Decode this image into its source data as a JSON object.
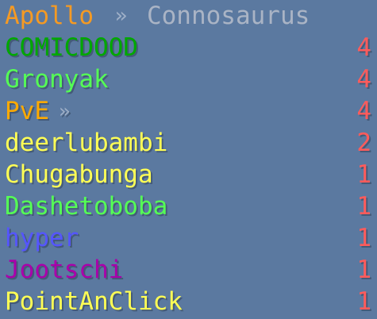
{
  "header": {
    "team": "Apollo",
    "separator": "»",
    "server": "Connosaurus"
  },
  "colors": {
    "background": "#5b79a0",
    "team": "#f59a23",
    "separator": "#9fb0c8",
    "server": "#aab4c5",
    "score": "#ff5b5b"
  },
  "scoreboard": [
    {
      "name": "COMICDOOD",
      "score": "4",
      "color": "#00a800",
      "suffix": ""
    },
    {
      "name": "Gronyak",
      "score": "4",
      "color": "#55ff55",
      "suffix": ""
    },
    {
      "name": "PvE",
      "score": "4",
      "color": "#ffaa00",
      "suffix": "»"
    },
    {
      "name": "deerlubambi",
      "score": "2",
      "color": "#ffff55",
      "suffix": ""
    },
    {
      "name": "Chugabunga",
      "score": "1",
      "color": "#ffff55",
      "suffix": ""
    },
    {
      "name": "Dashetoboba",
      "score": "1",
      "color": "#55ff55",
      "suffix": ""
    },
    {
      "name": "hyper",
      "score": "1",
      "color": "#5555ff",
      "suffix": ""
    },
    {
      "name": "Jootschi",
      "score": "1",
      "color": "#aa00aa",
      "suffix": ""
    },
    {
      "name": "PointAnClick",
      "score": "1",
      "color": "#ffff55",
      "suffix": ""
    }
  ]
}
